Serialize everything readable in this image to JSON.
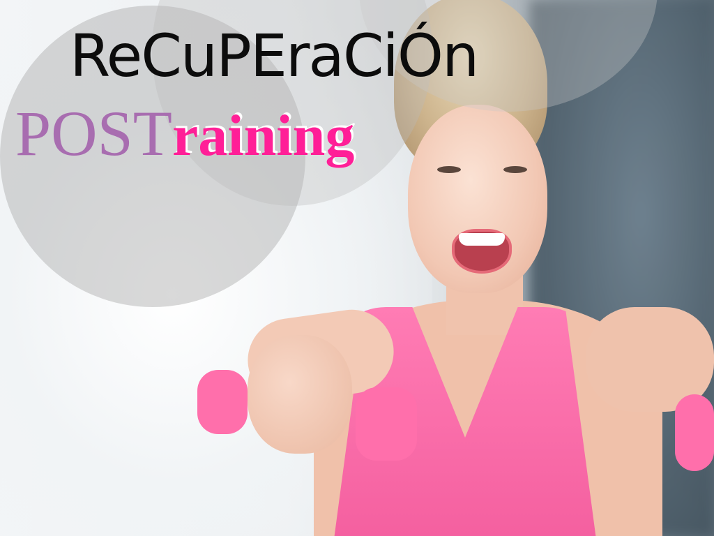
{
  "image": {
    "headline_top": "ReCuPEraCiÓn",
    "headline_bottom_part1": "POST",
    "headline_bottom_part2": "raining"
  },
  "colors": {
    "headline_top": "#0c0c0c",
    "headline_post": "#a86db0",
    "headline_raining": "#ff1f97",
    "tank_top": "#f45f9f",
    "dumbbells": "#ff6fab",
    "overlay_circles": "#aaaaaa"
  }
}
